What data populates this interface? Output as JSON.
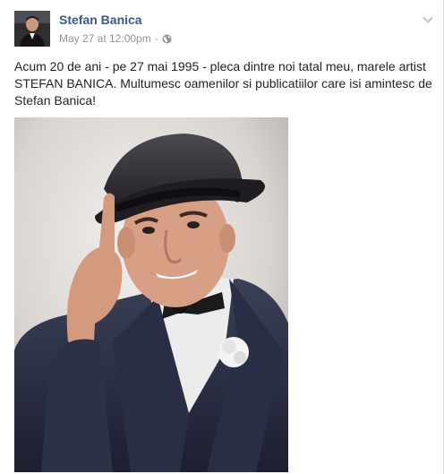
{
  "post": {
    "author": "Stefan Banica",
    "timestamp": "May 27 at 12:00pm",
    "separator": "·",
    "audience_icon": "globe-icon",
    "options_icon": "chevron-down-icon",
    "text": "Acum 20 de ani - pe 27 mai 1995 - pleca dintre noi tatal meu, marele artist STEFAN BANICA. Multumesc oamenilor si publicatiilor care isi amintesc de Stefan Banica!",
    "photo_description_icon": "photo-of-man-in-hat"
  },
  "colors": {
    "author_link": "#365899",
    "meta_text": "#90949c",
    "body_text": "#1d2129"
  }
}
